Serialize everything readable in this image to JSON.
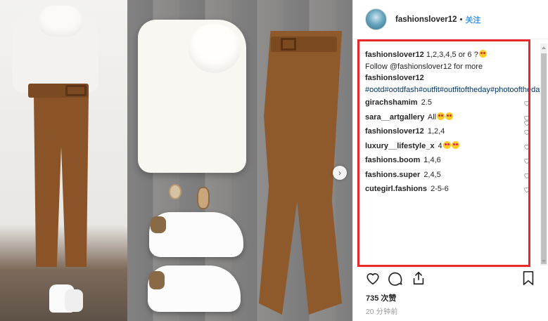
{
  "post": {
    "username": "fashionslover12",
    "separator": "•",
    "follow_label": "关注",
    "next_arrow": "›",
    "caption": {
      "username": "fashionslover12",
      "text_1": " 1,2,3,4,5 or 6 ?",
      "text_2": "Follow @fashionslover12 for more",
      "username_2": "fashionslover12",
      "hashtags": " #ootd#ootdfash#outfit#outfitoftheday#photooftheday#lookoftheday#clothes#clothing#followme#f4f#l4l#likeforlike#ootdwatch#like4like#fashion#lips#followforfollow#nails#tutorial#shoes#amazing#fashionblogger#igfashion#lookbook#style#nailsoftheday#loveit#collage#dress"
    },
    "comments": [
      {
        "user": "girachshamim",
        "text": "2.5",
        "emoji": 0
      },
      {
        "user": "sara__artgallery",
        "text": "All",
        "emoji": 2
      },
      {
        "user": "fashionslover12",
        "text": "1,2,4",
        "emoji": 0
      },
      {
        "user": "luxury__lifestyle_x",
        "text": "4",
        "emoji": 2
      },
      {
        "user": "fashions.boom",
        "text": "1,4,6",
        "emoji": 0
      },
      {
        "user": "fashions.super",
        "text": "2,4,5",
        "emoji": 0
      },
      {
        "user": "cutegirl.fashions",
        "text": "2-5-6",
        "emoji": 0
      }
    ],
    "likes": "735 次赞",
    "time": "20 分钟前",
    "icons": {
      "like": "heart-icon",
      "comment": "comment-icon",
      "share": "share-icon",
      "save": "bookmark-icon"
    },
    "colors": {
      "link": "#3897f0",
      "hashtag": "#003569",
      "highlight": "#e8282b"
    }
  }
}
